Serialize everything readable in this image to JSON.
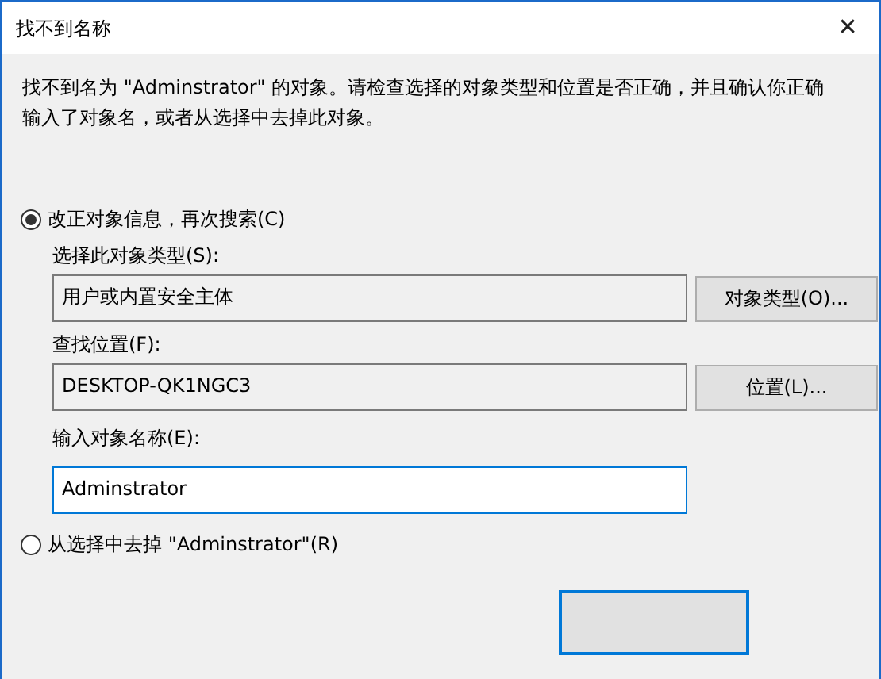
{
  "window": {
    "title": "找不到名称",
    "close": "✕"
  },
  "message": "找不到名为 \"Adminstrator\" 的对象。请检查选择的对象类型和位置是否正确，并且确认你正确输入了对象名，或者从选择中去掉此对象。",
  "options": [
    {
      "label": "改正对象信息，再次搜索(C)",
      "selected": true
    },
    {
      "label": "从选择中去掉 \"Adminstrator\"(R)",
      "selected": false
    }
  ],
  "object_type": {
    "label": "选择此对象类型(S):",
    "value": "用户或内置安全主体",
    "button": "对象类型(O)..."
  },
  "location": {
    "label": "查找位置(F):",
    "value": "DESKTOP-QK1NGC3",
    "button": "位置(L)..."
  },
  "object_name": {
    "label": "输入对象名称(E):",
    "value": "Adminstrator"
  }
}
